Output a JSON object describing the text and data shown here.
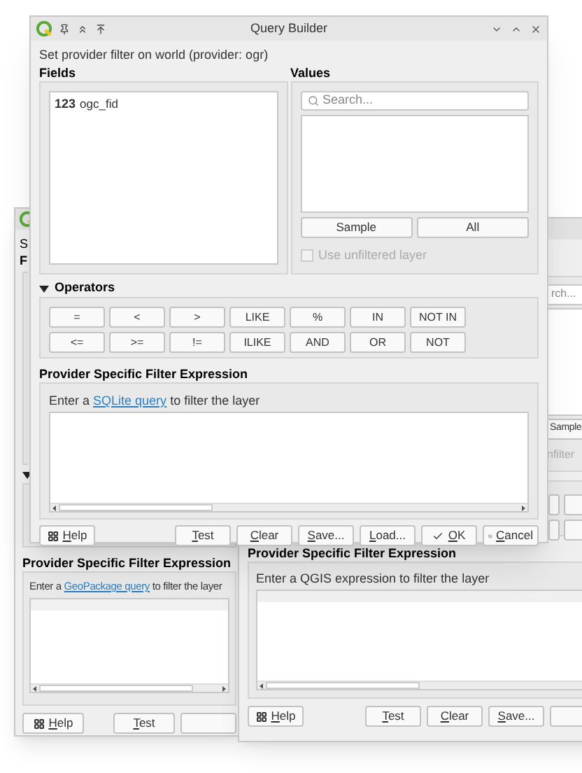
{
  "back_window": {
    "description": "S",
    "fields_label": "F",
    "filter_heading": "Provider Specific Filter Expression",
    "hint": {
      "before": "Enter a ",
      "link": "GeoPackage query",
      "after": " to filter the layer"
    },
    "buttons": [
      {
        "label": "Help",
        "kind": "help"
      },
      {
        "label": "Test",
        "kind": "plain"
      }
    ]
  },
  "middle_window": {
    "search_placeholder": "rch...",
    "sample_button": "Sample",
    "unfiltered_label": "nfilter",
    "filter_heading": "Provider Specific Filter Expression",
    "hint": "Enter a QGIS expression to filter the layer",
    "buttons": [
      {
        "label": "Help",
        "kind": "help"
      },
      {
        "label": "Test",
        "kind": "plain"
      },
      {
        "label": "Clear",
        "kind": "plain"
      },
      {
        "label": "Save...",
        "kind": "plain"
      }
    ]
  },
  "front_window": {
    "title": "Query Builder",
    "description": "Set provider filter on world (provider: ogr)",
    "fields": {
      "label": "Fields",
      "items": [
        {
          "type": "123",
          "name": "ogc_fid",
          "selected": false
        }
      ]
    },
    "values": {
      "label": "Values",
      "search_placeholder": "Search...",
      "buttons": [
        "Sample",
        "All"
      ],
      "unfiltered": {
        "label": "Use unfiltered layer",
        "checked": false,
        "disabled": true
      }
    },
    "operators": {
      "label": "Operators",
      "expanded": true,
      "rows": [
        [
          "=",
          "<",
          ">",
          "LIKE",
          "%",
          "IN",
          "NOT IN"
        ],
        [
          "<=",
          ">=",
          "!=",
          "ILIKE",
          "AND",
          "OR",
          "NOT"
        ]
      ]
    },
    "filter_heading": "Provider Specific Filter Expression",
    "hint": {
      "before": "Enter a ",
      "link": "SQLite query",
      "after": " to filter the layer"
    },
    "buttons": [
      {
        "label": "Help",
        "kind": "help"
      },
      {
        "label": "Test",
        "kind": "plain"
      },
      {
        "label": "Clear",
        "kind": "plain"
      },
      {
        "label": "Save...",
        "kind": "plain"
      },
      {
        "label": "Load...",
        "kind": "plain"
      },
      {
        "label": "OK",
        "kind": "ok"
      },
      {
        "label": "Cancel",
        "kind": "cancel"
      }
    ]
  }
}
